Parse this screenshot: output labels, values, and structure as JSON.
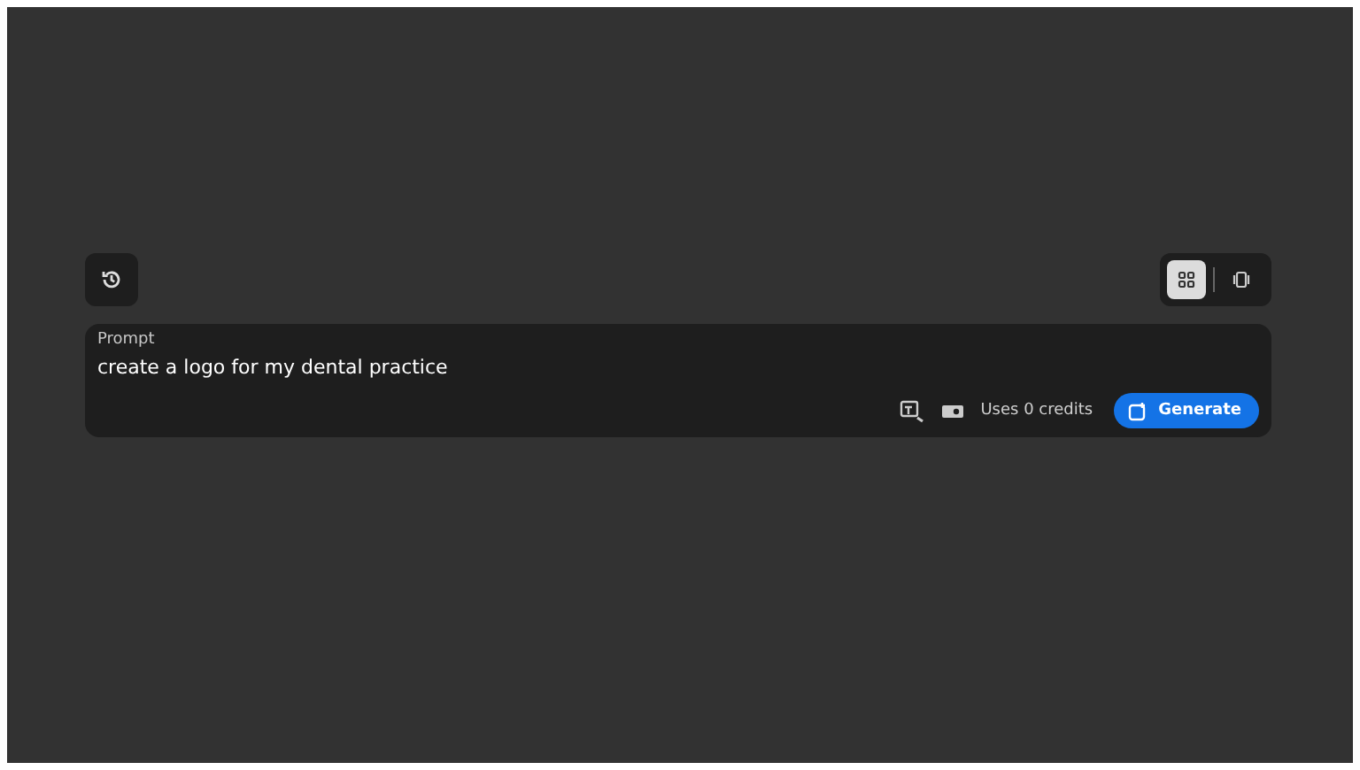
{
  "prompt": {
    "label": "Prompt",
    "value": "create a logo for my dental practice"
  },
  "view_modes": [
    {
      "kind": "grid",
      "selected": true
    },
    {
      "kind": "carousel",
      "selected": false
    }
  ],
  "credits": "Uses 0 credits",
  "generate_button": "Generate"
}
